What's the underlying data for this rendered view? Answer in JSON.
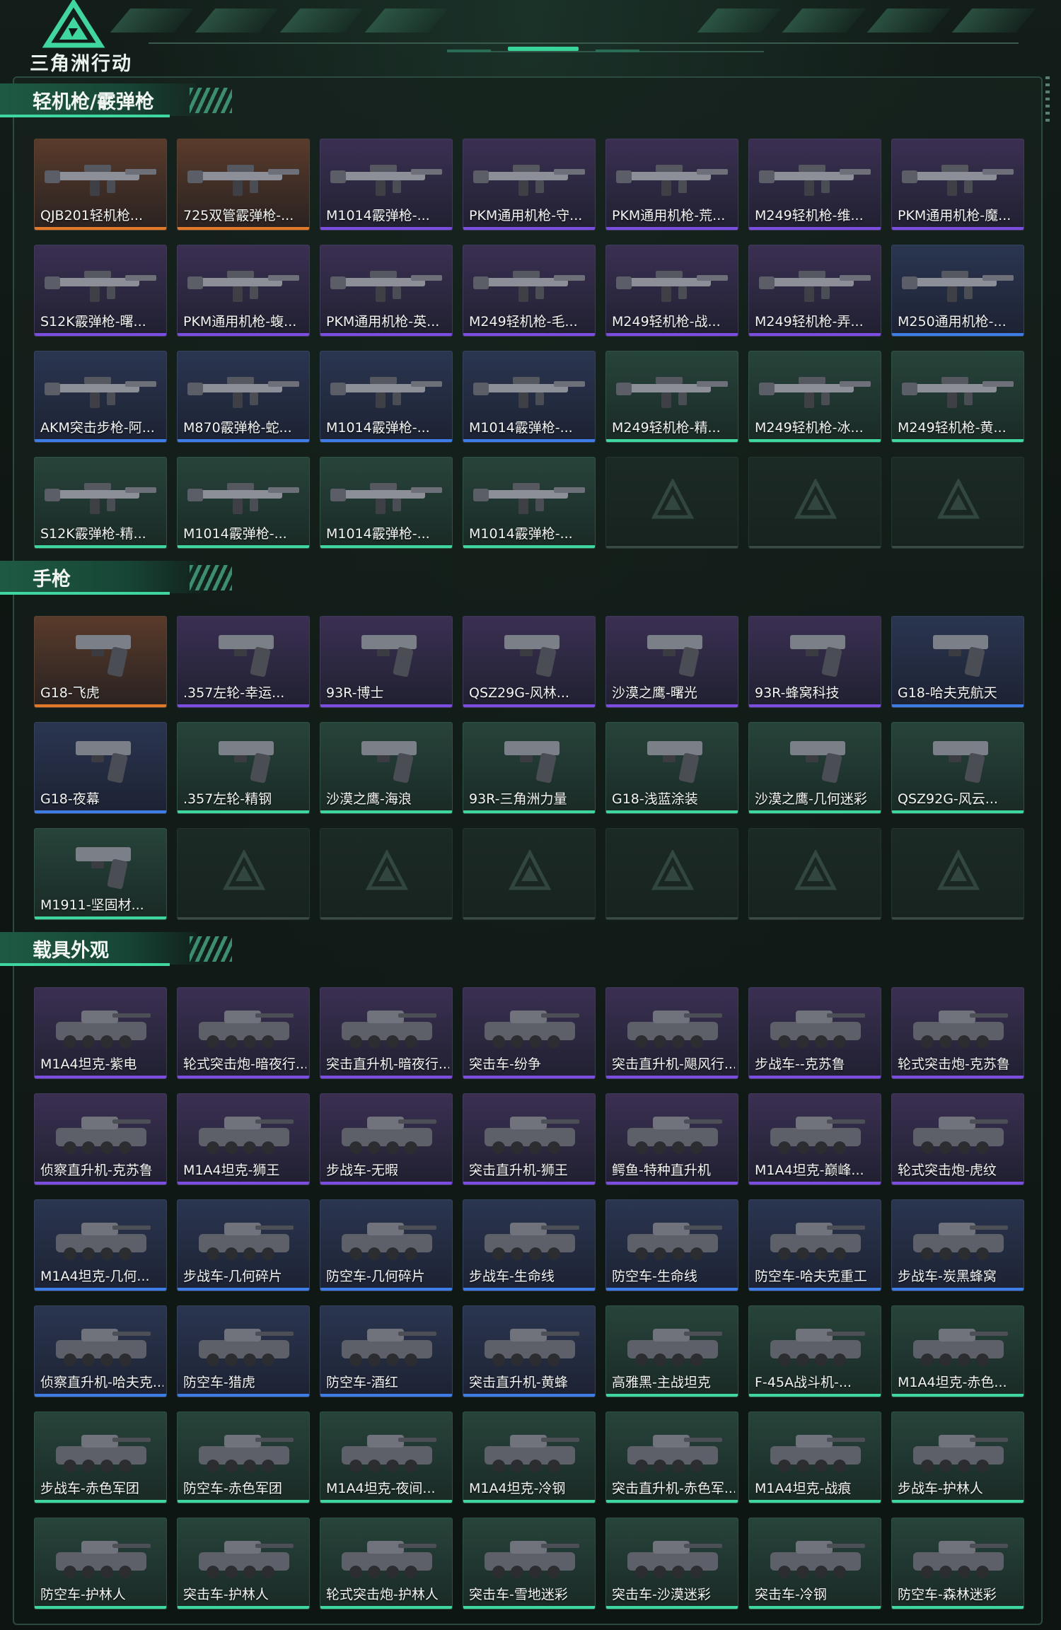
{
  "app": {
    "logo_text": "三角洲行动",
    "logo_icon": "delta-triangle-icon"
  },
  "colors": {
    "orange": "#e07a2a",
    "purple": "#7b4de0",
    "blue": "#3f7de6",
    "green": "#3fd7a0",
    "accent": "#3fd7a0"
  },
  "sections": [
    {
      "title": "轻机枪/霰弹枪",
      "kind": "gun",
      "items": [
        {
          "label": "QJB201轻机枪...",
          "rarity": "orange"
        },
        {
          "label": "725双管霰弹枪-...",
          "rarity": "orange"
        },
        {
          "label": "M1014霰弹枪-...",
          "rarity": "purple"
        },
        {
          "label": "PKM通用机枪-守...",
          "rarity": "purple"
        },
        {
          "label": "PKM通用机枪-荒...",
          "rarity": "purple"
        },
        {
          "label": "M249轻机枪-维...",
          "rarity": "purple"
        },
        {
          "label": "PKM通用机枪-魔...",
          "rarity": "purple"
        },
        {
          "label": "S12K霰弹枪-曙...",
          "rarity": "purple"
        },
        {
          "label": "PKM通用机枪-蝮...",
          "rarity": "purple"
        },
        {
          "label": "PKM通用机枪-英...",
          "rarity": "purple"
        },
        {
          "label": "M249轻机枪-毛...",
          "rarity": "purple"
        },
        {
          "label": "M249轻机枪-战...",
          "rarity": "purple"
        },
        {
          "label": "M249轻机枪-弄...",
          "rarity": "purple"
        },
        {
          "label": "M250通用机枪-...",
          "rarity": "blue"
        },
        {
          "label": "AKM突击步枪-阿...",
          "rarity": "blue"
        },
        {
          "label": "M870霰弹枪-蛇...",
          "rarity": "blue"
        },
        {
          "label": "M1014霰弹枪-...",
          "rarity": "blue"
        },
        {
          "label": "M1014霰弹枪-...",
          "rarity": "blue"
        },
        {
          "label": "M249轻机枪-精...",
          "rarity": "green"
        },
        {
          "label": "M249轻机枪-冰...",
          "rarity": "green"
        },
        {
          "label": "M249轻机枪-黄...",
          "rarity": "green"
        },
        {
          "label": "S12K霰弹枪-精...",
          "rarity": "green"
        },
        {
          "label": "M1014霰弹枪-...",
          "rarity": "green"
        },
        {
          "label": "M1014霰弹枪-...",
          "rarity": "green"
        },
        {
          "label": "M1014霰弹枪-...",
          "rarity": "green"
        },
        {
          "label": "",
          "rarity": "empty"
        },
        {
          "label": "",
          "rarity": "empty"
        },
        {
          "label": "",
          "rarity": "empty"
        }
      ]
    },
    {
      "title": "手枪",
      "kind": "pistol",
      "items": [
        {
          "label": "G18-飞虎",
          "rarity": "orange"
        },
        {
          "label": ".357左轮-幸运...",
          "rarity": "purple"
        },
        {
          "label": "93R-博士",
          "rarity": "purple"
        },
        {
          "label": "QSZ29G-风林...",
          "rarity": "purple"
        },
        {
          "label": "沙漠之鹰-曙光",
          "rarity": "purple"
        },
        {
          "label": "93R-蜂窝科技",
          "rarity": "purple"
        },
        {
          "label": "G18-哈夫克航天",
          "rarity": "blue"
        },
        {
          "label": "G18-夜幕",
          "rarity": "blue"
        },
        {
          "label": ".357左轮-精钢",
          "rarity": "green"
        },
        {
          "label": "沙漠之鹰-海浪",
          "rarity": "green"
        },
        {
          "label": "93R-三角洲力量",
          "rarity": "green"
        },
        {
          "label": "G18-浅蓝涂装",
          "rarity": "green"
        },
        {
          "label": "沙漠之鹰-几何迷彩",
          "rarity": "green"
        },
        {
          "label": "QSZ92G-风云...",
          "rarity": "green"
        },
        {
          "label": "M1911-坚固材...",
          "rarity": "green"
        },
        {
          "label": "",
          "rarity": "empty"
        },
        {
          "label": "",
          "rarity": "empty"
        },
        {
          "label": "",
          "rarity": "empty"
        },
        {
          "label": "",
          "rarity": "empty"
        },
        {
          "label": "",
          "rarity": "empty"
        },
        {
          "label": "",
          "rarity": "empty"
        }
      ]
    },
    {
      "title": "载具外观",
      "kind": "vehicle",
      "items": [
        {
          "label": "M1A4坦克-紫电",
          "rarity": "purple"
        },
        {
          "label": "轮式突击炮-暗夜行...",
          "rarity": "purple"
        },
        {
          "label": "突击直升机-暗夜行...",
          "rarity": "purple"
        },
        {
          "label": "突击车-纷争",
          "rarity": "purple"
        },
        {
          "label": "突击直升机-飓风行...",
          "rarity": "purple"
        },
        {
          "label": "步战车--克苏鲁",
          "rarity": "purple"
        },
        {
          "label": "轮式突击炮-克苏鲁",
          "rarity": "purple"
        },
        {
          "label": "侦察直升机-克苏鲁",
          "rarity": "purple"
        },
        {
          "label": "M1A4坦克-狮王",
          "rarity": "purple"
        },
        {
          "label": "步战车-无暇",
          "rarity": "purple"
        },
        {
          "label": "突击直升机-狮王",
          "rarity": "purple"
        },
        {
          "label": "鳄鱼-特种直升机",
          "rarity": "purple"
        },
        {
          "label": "M1A4坦克-巅峰...",
          "rarity": "purple"
        },
        {
          "label": "轮式突击炮-虎纹",
          "rarity": "purple"
        },
        {
          "label": "M1A4坦克-几何...",
          "rarity": "blue"
        },
        {
          "label": "步战车-几何碎片",
          "rarity": "blue"
        },
        {
          "label": "防空车-几何碎片",
          "rarity": "blue"
        },
        {
          "label": "步战车-生命线",
          "rarity": "blue"
        },
        {
          "label": "防空车-生命线",
          "rarity": "blue"
        },
        {
          "label": "防空车-哈夫克重工",
          "rarity": "blue"
        },
        {
          "label": "步战车-炭黑蜂窝",
          "rarity": "blue"
        },
        {
          "label": "侦察直升机-哈夫克...",
          "rarity": "blue"
        },
        {
          "label": "防空车-猎虎",
          "rarity": "blue"
        },
        {
          "label": "防空车-酒红",
          "rarity": "blue"
        },
        {
          "label": "突击直升机-黄蜂",
          "rarity": "blue"
        },
        {
          "label": "高雅黑-主战坦克",
          "rarity": "green"
        },
        {
          "label": "F-45A战斗机-...",
          "rarity": "green"
        },
        {
          "label": "M1A4坦克-赤色...",
          "rarity": "green"
        },
        {
          "label": "步战车-赤色军团",
          "rarity": "green"
        },
        {
          "label": "防空车-赤色军团",
          "rarity": "green"
        },
        {
          "label": "M1A4坦克-夜间...",
          "rarity": "green"
        },
        {
          "label": "M1A4坦克-冷钢",
          "rarity": "green"
        },
        {
          "label": "突击直升机-赤色军...",
          "rarity": "green"
        },
        {
          "label": "M1A4坦克-战痕",
          "rarity": "green"
        },
        {
          "label": "步战车-护林人",
          "rarity": "green"
        },
        {
          "label": "防空车-护林人",
          "rarity": "green"
        },
        {
          "label": "突击车-护林人",
          "rarity": "green"
        },
        {
          "label": "轮式突击炮-护林人",
          "rarity": "green"
        },
        {
          "label": "突击车-雪地迷彩",
          "rarity": "green"
        },
        {
          "label": "突击车-沙漠迷彩",
          "rarity": "green"
        },
        {
          "label": "突击车-冷钢",
          "rarity": "green"
        },
        {
          "label": "防空车-森林迷彩",
          "rarity": "green"
        }
      ]
    }
  ]
}
